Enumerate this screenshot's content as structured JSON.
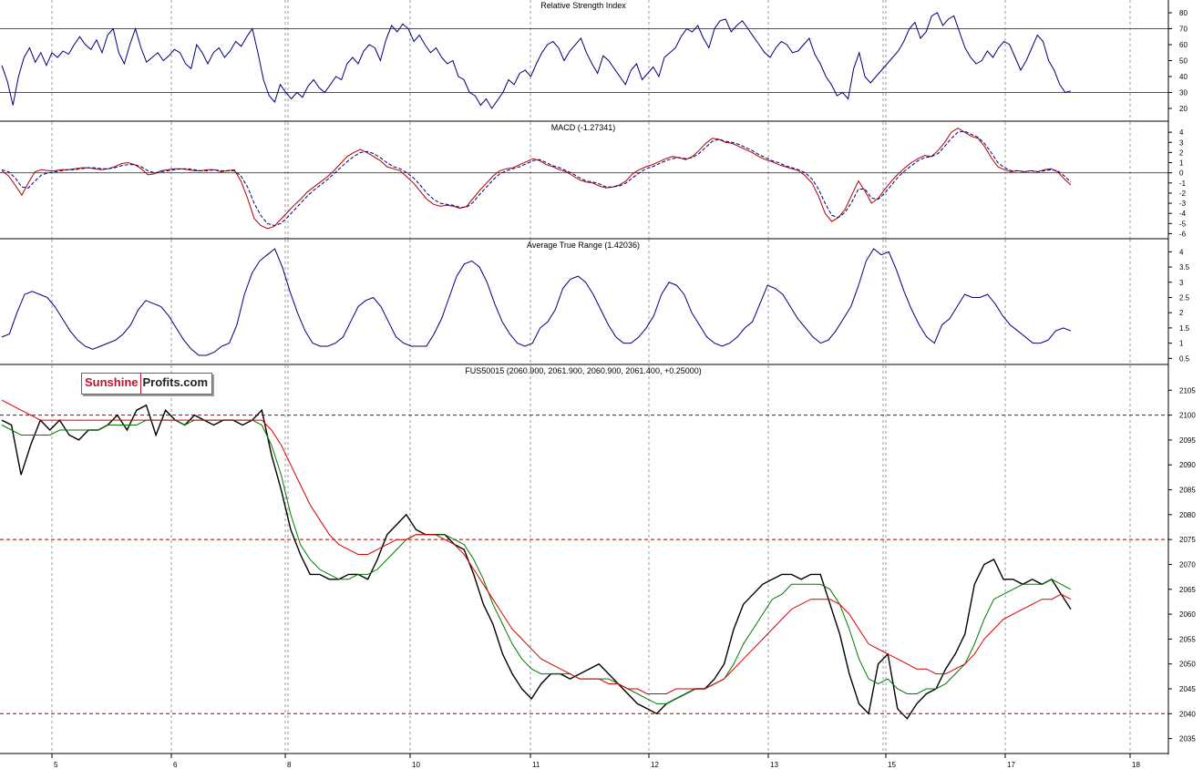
{
  "logo": {
    "part1": "Sunshine",
    "part2": "Profits.com"
  },
  "chart_data": [
    {
      "type": "line",
      "title": "Relative Strength Index",
      "ylim": [
        12,
        88
      ],
      "yticks": [
        20,
        30,
        40,
        50,
        60,
        70,
        80
      ],
      "reference_lines": [
        30,
        70
      ],
      "series": [
        {
          "color": "#00007a",
          "values": [
            47,
            37,
            22,
            40,
            52,
            58,
            49,
            55,
            47,
            55,
            52,
            56,
            54,
            60,
            65,
            60,
            57,
            63,
            55,
            66,
            70,
            55,
            48,
            60,
            70,
            58,
            49,
            52,
            55,
            50,
            53,
            57,
            55,
            48,
            45,
            60,
            55,
            48,
            55,
            58,
            52,
            56,
            62,
            59,
            65,
            70,
            55,
            38,
            28,
            24,
            35,
            30,
            26,
            30,
            27,
            34,
            38,
            33,
            30,
            35,
            40,
            38,
            48,
            52,
            48,
            56,
            60,
            58,
            50,
            63,
            72,
            68,
            73,
            70,
            62,
            66,
            60,
            55,
            58,
            52,
            48,
            50,
            40,
            38,
            30,
            28,
            22,
            26,
            20,
            25,
            30,
            38,
            35,
            42,
            44,
            40,
            48,
            55,
            60,
            62,
            58,
            50,
            56,
            60,
            64,
            55,
            48,
            42,
            53,
            50,
            45,
            40,
            35,
            44,
            48,
            38,
            42,
            46,
            40,
            52,
            55,
            58,
            65,
            70,
            68,
            72,
            64,
            58,
            70,
            75,
            76,
            68,
            72,
            75,
            70,
            65,
            60,
            55,
            52,
            58,
            62,
            60,
            55,
            56,
            60,
            64,
            54,
            48,
            40,
            35,
            28,
            30,
            26,
            45,
            55,
            40,
            36,
            40,
            44,
            48,
            52,
            56,
            62,
            70,
            74,
            64,
            68,
            78,
            80,
            72,
            76,
            78,
            68,
            58,
            52,
            48,
            50,
            56,
            52,
            58,
            62,
            60,
            52,
            44,
            50,
            58,
            66,
            62,
            50,
            44,
            35,
            30,
            31
          ]
        }
      ]
    },
    {
      "type": "line",
      "title": "MACD (-1.27341)",
      "ylim": [
        -6.5,
        5
      ],
      "yticks": [
        -6,
        -5,
        -4,
        -3,
        -2,
        -1,
        0,
        1,
        2,
        3,
        4
      ],
      "reference_lines": [
        0
      ],
      "series": [
        {
          "name": "MACD",
          "color": "#b00000",
          "values": [
            0.2,
            -0.3,
            -1.2,
            -2.2,
            -1.0,
            0.1,
            0.3,
            0.2,
            0.2,
            0.3,
            0.3,
            0.4,
            0.5,
            0.5,
            0.4,
            0.3,
            0.4,
            0.6,
            0.9,
            1.0,
            0.8,
            0.4,
            -0.2,
            -0.1,
            0.2,
            0.3,
            0.4,
            0.4,
            0.3,
            0.2,
            0.2,
            0.3,
            0.3,
            0.1,
            0.2,
            0.3,
            -0.8,
            -2.5,
            -4.5,
            -5.2,
            -5.5,
            -5.3,
            -4.6,
            -3.9,
            -3.2,
            -2.6,
            -1.9,
            -1.4,
            -0.9,
            -0.4,
            0.2,
            0.9,
            1.6,
            2.0,
            2.3,
            2.0,
            1.6,
            1.2,
            0.6,
            0.4,
            0.2,
            -0.4,
            -1.0,
            -1.8,
            -2.6,
            -3.1,
            -3.3,
            -3.2,
            -3.3,
            -3.5,
            -3.3,
            -2.5,
            -1.7,
            -1.0,
            -0.3,
            0.2,
            0.4,
            0.5,
            0.8,
            1.1,
            1.4,
            1.2,
            0.8,
            0.6,
            0.3,
            0.1,
            -0.3,
            -0.7,
            -0.9,
            -1.0,
            -1.3,
            -1.5,
            -1.4,
            -1.2,
            -0.8,
            -0.1,
            0.3,
            0.6,
            0.8,
            1.1,
            1.4,
            1.6,
            1.5,
            1.3,
            1.6,
            2.2,
            2.9,
            3.4,
            3.3,
            3.0,
            2.9,
            2.6,
            2.3,
            2.0,
            1.6,
            1.3,
            1.1,
            0.8,
            0.6,
            0.4,
            0.2,
            -0.3,
            -1.0,
            -2.3,
            -4.0,
            -4.8,
            -4.4,
            -3.6,
            -2.2,
            -0.8,
            -1.8,
            -3.0,
            -2.5,
            -1.6,
            -0.8,
            -0.1,
            0.5,
            1.0,
            1.4,
            1.7,
            1.6,
            2.2,
            3.0,
            4.0,
            4.4,
            4.0,
            3.6,
            3.4,
            2.6,
            1.5,
            0.6,
            0.3,
            0.1,
            0.2,
            0.1,
            0.2,
            0.1,
            0.3,
            0.4,
            0.1,
            -0.6,
            -1.2
          ]
        },
        {
          "name": "Signal",
          "color": "#000080",
          "dashed": true,
          "values": [
            0.3,
            0.1,
            -0.5,
            -1.4,
            -1.5,
            -0.8,
            -0.2,
            0.0,
            0.1,
            0.2,
            0.3,
            0.3,
            0.4,
            0.5,
            0.5,
            0.4,
            0.4,
            0.5,
            0.7,
            0.8,
            0.8,
            0.6,
            0.2,
            0.0,
            0.1,
            0.2,
            0.3,
            0.4,
            0.4,
            0.3,
            0.2,
            0.2,
            0.3,
            0.2,
            0.2,
            0.2,
            -0.3,
            -1.4,
            -3.0,
            -4.2,
            -5.0,
            -5.2,
            -5.0,
            -4.4,
            -3.7,
            -3.0,
            -2.3,
            -1.7,
            -1.2,
            -0.7,
            -0.1,
            0.5,
            1.1,
            1.6,
            2.0,
            2.1,
            1.9,
            1.5,
            1.0,
            0.6,
            0.4,
            0.0,
            -0.5,
            -1.2,
            -2.0,
            -2.6,
            -3.0,
            -3.1,
            -3.2,
            -3.4,
            -3.4,
            -2.9,
            -2.1,
            -1.4,
            -0.7,
            -0.1,
            0.2,
            0.4,
            0.6,
            0.9,
            1.2,
            1.3,
            1.0,
            0.7,
            0.5,
            0.2,
            -0.1,
            -0.5,
            -0.8,
            -0.9,
            -1.1,
            -1.4,
            -1.4,
            -1.3,
            -1.0,
            -0.5,
            0.0,
            0.4,
            0.6,
            0.9,
            1.2,
            1.4,
            1.5,
            1.4,
            1.5,
            1.9,
            2.5,
            3.1,
            3.3,
            3.1,
            3.0,
            2.8,
            2.5,
            2.2,
            1.8,
            1.5,
            1.2,
            1.0,
            0.7,
            0.5,
            0.3,
            0.0,
            -0.6,
            -1.6,
            -3.0,
            -4.2,
            -4.4,
            -3.9,
            -2.9,
            -1.6,
            -1.6,
            -2.5,
            -2.6,
            -2.0,
            -1.2,
            -0.4,
            0.2,
            0.7,
            1.2,
            1.5,
            1.6,
            1.9,
            2.6,
            3.4,
            4.0,
            4.1,
            3.8,
            3.5,
            2.9,
            2.0,
            1.0,
            0.5,
            0.2,
            0.2,
            0.1,
            0.2,
            0.1,
            0.2,
            0.3,
            0.2,
            -0.3,
            -0.9
          ]
        }
      ]
    },
    {
      "type": "line",
      "title": "Average True Range (1.42036)",
      "ylim": [
        0.3,
        4.4
      ],
      "yticks": [
        0.5,
        1.0,
        1.5,
        2.0,
        2.5,
        3.0,
        3.5,
        4.0
      ],
      "series": [
        {
          "color": "#00007a",
          "values": [
            1.2,
            1.3,
            2.0,
            2.6,
            2.7,
            2.6,
            2.5,
            2.2,
            1.8,
            1.4,
            1.1,
            0.9,
            0.8,
            0.9,
            1.0,
            1.1,
            1.3,
            1.6,
            2.1,
            2.4,
            2.3,
            2.2,
            1.9,
            1.5,
            1.1,
            0.8,
            0.6,
            0.6,
            0.7,
            0.9,
            1.0,
            1.6,
            2.6,
            3.3,
            3.7,
            3.9,
            4.1,
            3.5,
            2.7,
            2.0,
            1.4,
            1.0,
            0.9,
            0.9,
            1.0,
            1.2,
            1.7,
            2.2,
            2.4,
            2.5,
            2.2,
            1.7,
            1.2,
            1.0,
            0.9,
            0.9,
            0.9,
            1.3,
            1.8,
            2.5,
            3.2,
            3.6,
            3.7,
            3.5,
            3.0,
            2.3,
            1.7,
            1.3,
            1.0,
            0.9,
            1.0,
            1.5,
            1.7,
            2.1,
            2.8,
            3.1,
            3.2,
            3.0,
            2.6,
            2.1,
            1.6,
            1.2,
            1.0,
            1.0,
            1.2,
            1.5,
            1.9,
            2.6,
            3.0,
            2.9,
            2.6,
            2.0,
            1.6,
            1.2,
            1.0,
            0.9,
            1.0,
            1.2,
            1.5,
            1.7,
            2.3,
            2.9,
            2.8,
            2.6,
            2.2,
            1.8,
            1.5,
            1.2,
            1.0,
            1.1,
            1.4,
            1.8,
            2.2,
            2.9,
            3.7,
            4.1,
            3.9,
            4.0,
            3.4,
            2.7,
            2.1,
            1.6,
            1.2,
            1.0,
            1.6,
            1.8,
            2.2,
            2.6,
            2.5,
            2.5,
            2.6,
            2.3,
            1.9,
            1.6,
            1.4,
            1.2,
            1.0,
            1.0,
            1.1,
            1.4,
            1.5,
            1.4
          ]
        }
      ]
    },
    {
      "type": "line",
      "title": "FUS50015 (2060.900, 2061.900, 2060.900, 2061.400, +0.25000)",
      "ylim": [
        2032,
        2110
      ],
      "yticks": [
        2035,
        2040,
        2045,
        2050,
        2055,
        2060,
        2065,
        2070,
        2075,
        2080,
        2085,
        2090,
        2095,
        2100,
        2105
      ],
      "xticks": [
        "5",
        "6",
        "8",
        "10",
        "11",
        "12",
        "13",
        "15",
        "17",
        "18"
      ],
      "reference_lines": [
        2100,
        2075,
        2040
      ],
      "series": [
        {
          "name": "Price",
          "color": "#000000",
          "values": [
            2099,
            2098,
            2088,
            2094,
            2099,
            2097,
            2099,
            2096,
            2095,
            2097,
            2097,
            2098,
            2100,
            2097,
            2101,
            2102,
            2096,
            2101,
            2099,
            2098,
            2100,
            2099,
            2098,
            2099,
            2099,
            2098,
            2099,
            2101,
            2092,
            2085,
            2077,
            2072,
            2068,
            2068,
            2067,
            2067,
            2068,
            2068,
            2067,
            2071,
            2076,
            2078,
            2080,
            2077,
            2076,
            2076,
            2076,
            2074,
            2073,
            2068,
            2062,
            2058,
            2052,
            2048,
            2045,
            2043,
            2046,
            2048,
            2048,
            2047,
            2048,
            2049,
            2050,
            2048,
            2046,
            2044,
            2042,
            2041,
            2040,
            2042,
            2043,
            2044,
            2045,
            2045,
            2047,
            2050,
            2057,
            2062,
            2064,
            2066,
            2067,
            2068,
            2068,
            2067,
            2068,
            2068,
            2062,
            2056,
            2048,
            2042,
            2040,
            2050,
            2052,
            2041,
            2039,
            2042,
            2044,
            2045,
            2049,
            2052,
            2056,
            2066,
            2070,
            2071,
            2067,
            2067,
            2066,
            2067,
            2066,
            2067,
            2064,
            2061
          ]
        },
        {
          "name": "MA short",
          "color": "#007a00",
          "values": [
            2098,
            2097,
            2096,
            2096,
            2096,
            2096,
            2097,
            2097,
            2097,
            2097,
            2097,
            2098,
            2098,
            2098,
            2098,
            2099,
            2099,
            2099,
            2099,
            2098,
            2099,
            2099,
            2099,
            2099,
            2099,
            2099,
            2099,
            2098,
            2094,
            2088,
            2080,
            2074,
            2071,
            2069,
            2068,
            2067,
            2067,
            2068,
            2068,
            2069,
            2071,
            2073,
            2075,
            2076,
            2076,
            2076,
            2076,
            2075,
            2074,
            2071,
            2067,
            2062,
            2058,
            2054,
            2051,
            2049,
            2048,
            2048,
            2048,
            2048,
            2047,
            2047,
            2047,
            2047,
            2046,
            2045,
            2044,
            2043,
            2042,
            2042,
            2043,
            2044,
            2045,
            2045,
            2046,
            2047,
            2050,
            2054,
            2057,
            2060,
            2063,
            2064,
            2066,
            2066,
            2066,
            2066,
            2065,
            2062,
            2057,
            2051,
            2047,
            2046,
            2047,
            2045,
            2044,
            2044,
            2045,
            2045,
            2046,
            2048,
            2050,
            2054,
            2059,
            2063,
            2064,
            2065,
            2066,
            2066,
            2066,
            2067,
            2066,
            2065
          ]
        },
        {
          "name": "MA long",
          "color": "#d80000",
          "values": [
            2103,
            2102,
            2101,
            2100,
            2099,
            2099,
            2099,
            2099,
            2099,
            2099,
            2099,
            2099,
            2099,
            2099,
            2099,
            2099,
            2099,
            2099,
            2099,
            2099,
            2099,
            2099,
            2099,
            2099,
            2099,
            2099,
            2099,
            2099,
            2097,
            2094,
            2090,
            2086,
            2082,
            2079,
            2076,
            2074,
            2073,
            2072,
            2072,
            2073,
            2074,
            2075,
            2075,
            2076,
            2076,
            2076,
            2075,
            2074,
            2072,
            2069,
            2066,
            2063,
            2060,
            2057,
            2055,
            2053,
            2051,
            2050,
            2049,
            2048,
            2047,
            2047,
            2047,
            2046,
            2046,
            2045,
            2045,
            2044,
            2044,
            2044,
            2045,
            2045,
            2045,
            2045,
            2046,
            2047,
            2049,
            2051,
            2053,
            2055,
            2057,
            2059,
            2061,
            2062,
            2063,
            2063,
            2063,
            2062,
            2060,
            2057,
            2054,
            2053,
            2052,
            2051,
            2050,
            2049,
            2049,
            2048,
            2048,
            2049,
            2050,
            2052,
            2055,
            2057,
            2059,
            2060,
            2061,
            2062,
            2063,
            2063,
            2064,
            2063
          ]
        }
      ]
    }
  ]
}
